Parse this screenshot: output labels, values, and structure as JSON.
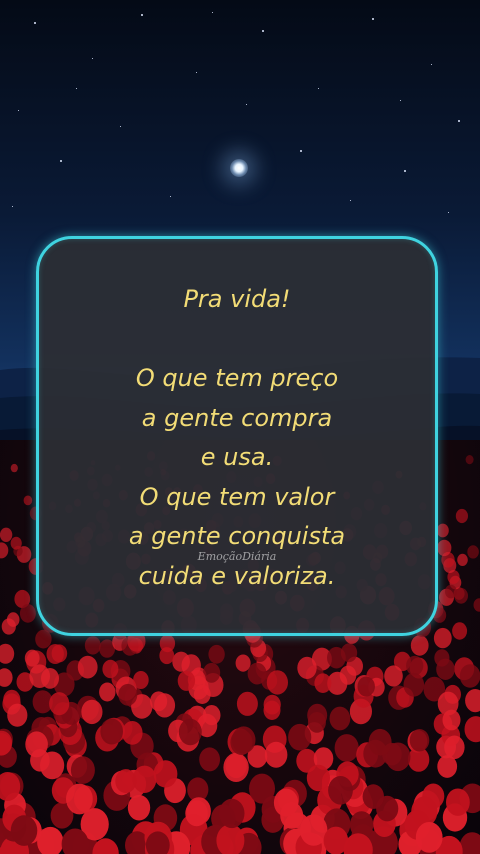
{
  "card": {
    "title": "Pra vida!",
    "lines": [
      "O que tem preço",
      "a gente compra",
      "e usa.",
      "O que tem valor",
      "a gente conquista",
      "cuida e valoriza."
    ],
    "watermark": "EmoçãoDiária"
  },
  "colors": {
    "text": "#f2dc76",
    "border": "#3fd3e0",
    "card_bg": "#2c2e34",
    "flowers": "#c2121e"
  },
  "scene": {
    "elements": [
      "night-sky",
      "stars",
      "moon",
      "hills",
      "red-flower-field"
    ]
  }
}
